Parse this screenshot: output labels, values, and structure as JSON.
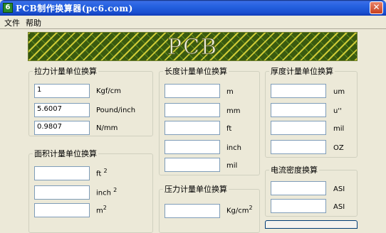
{
  "window": {
    "title": "PCB制作换算器(pc6.com)",
    "icon_label": "6"
  },
  "menu": [
    {
      "label": "文件"
    },
    {
      "label": "帮助"
    }
  ],
  "banner": {
    "text": "PCB"
  },
  "groups": {
    "tension": {
      "legend": "拉力计量单位换算",
      "rows": [
        {
          "value": "1",
          "unit": "Kgf/cm"
        },
        {
          "value": "5.6007",
          "unit": "Pound/inch"
        },
        {
          "value": "0.9807",
          "unit": "N/mm"
        }
      ]
    },
    "length": {
      "legend": "长度计量单位换算",
      "rows": [
        {
          "value": "",
          "unit": "m"
        },
        {
          "value": "",
          "unit": "mm"
        },
        {
          "value": "",
          "unit": "ft"
        },
        {
          "value": "",
          "unit": "inch"
        },
        {
          "value": "",
          "unit": "mil"
        }
      ]
    },
    "thickness": {
      "legend": "厚度计量单位换算",
      "rows": [
        {
          "value": "",
          "unit": "um"
        },
        {
          "value": "",
          "unit": "u''"
        },
        {
          "value": "",
          "unit": "mil"
        },
        {
          "value": "",
          "unit": "OZ"
        }
      ]
    },
    "area": {
      "legend": "面积计量单位换算",
      "rows": [
        {
          "value": "",
          "unit": "ft",
          "sup": "2"
        },
        {
          "value": "",
          "unit": "inch",
          "sup": "2"
        },
        {
          "value": "",
          "unit": "m",
          "sup": "2"
        }
      ]
    },
    "pressure": {
      "legend": "压力计量单位换算",
      "rows": [
        {
          "value": "",
          "unit": "Kg/cm",
          "sup": "2"
        }
      ]
    },
    "current_density": {
      "legend": "电流密度换算",
      "rows": [
        {
          "value": "",
          "unit": "ASI"
        },
        {
          "value": "",
          "unit": "ASI"
        }
      ]
    }
  }
}
